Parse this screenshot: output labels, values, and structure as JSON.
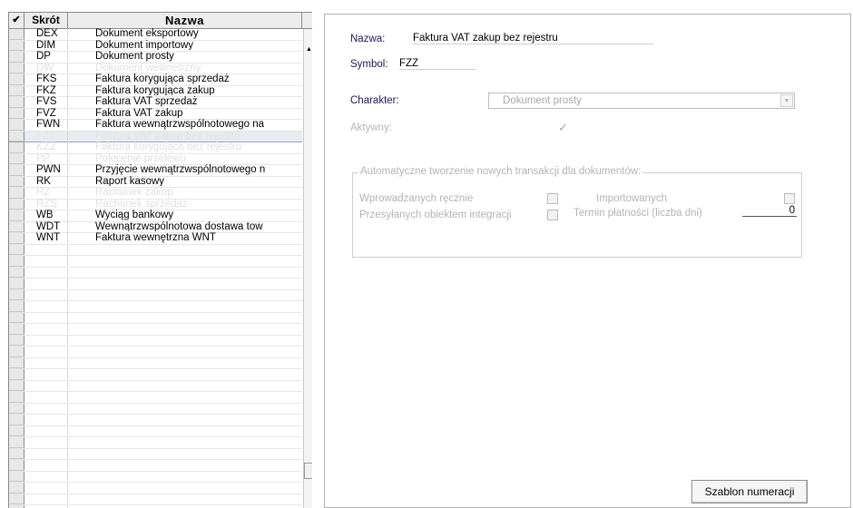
{
  "grid": {
    "header": {
      "check_icon": "checkmark-icon",
      "check_glyph": "✔",
      "col_skrot": "Skrót",
      "col_nazwa": "Nazwa"
    },
    "rows": [
      {
        "skrot": "DEX",
        "nazwa": "Dokument eksportowy",
        "faded": false
      },
      {
        "skrot": "DIM",
        "nazwa": "Dokument importowy",
        "faded": false
      },
      {
        "skrot": "DP",
        "nazwa": "Dokument prosty",
        "faded": false
      },
      {
        "skrot": "DW",
        "nazwa": "Dokument wewnętrzny",
        "faded": true
      },
      {
        "skrot": "FKS",
        "nazwa": "Faktura korygująca sprzedaż",
        "faded": false
      },
      {
        "skrot": "FKZ",
        "nazwa": "Faktura korygująca zakup",
        "faded": false
      },
      {
        "skrot": "FVS",
        "nazwa": "Faktura VAT sprzedaż",
        "faded": false
      },
      {
        "skrot": "FVZ",
        "nazwa": "Faktura VAT zakup",
        "faded": false
      },
      {
        "skrot": "FWN",
        "nazwa": "Faktura wewnątrzwspólnotowego na",
        "faded": false
      },
      {
        "skrot": "FZZ",
        "nazwa": "Faktura VAT zakup bez rejestru",
        "faded": true,
        "selected": true
      },
      {
        "skrot": "KZZ",
        "nazwa": "Faktura korygująca bez rejestru",
        "faded": true
      },
      {
        "skrot": "PP",
        "nazwa": "Polecenie przelewu",
        "faded": true
      },
      {
        "skrot": "PWN",
        "nazwa": "Przyjęcie wewnątrzwspólnotowego n",
        "faded": false
      },
      {
        "skrot": "RK",
        "nazwa": "Raport kasowy",
        "faded": false
      },
      {
        "skrot": "RZ",
        "nazwa": "Rachunek zakup",
        "faded": true
      },
      {
        "skrot": "RZS",
        "nazwa": "Rachunek sprzedaż",
        "faded": true
      },
      {
        "skrot": "WB",
        "nazwa": "Wyciąg bankowy",
        "faded": false
      },
      {
        "skrot": "WDT",
        "nazwa": "Wewnątrzwspólnotowa dostawa tow",
        "faded": false
      },
      {
        "skrot": "WNT",
        "nazwa": "Faktura wewnętrzna WNT",
        "faded": false
      }
    ],
    "empty_rows": 24,
    "scroll_up_glyph": "▲"
  },
  "form": {
    "nazwa_label": "Nazwa:",
    "nazwa_value": "Faktura VAT zakup bez rejestru",
    "symbol_label": "Symbol:",
    "symbol_value": "FZZ",
    "charakter_label": "Charakter:",
    "charakter_value": "Dokument prosty",
    "combo_arrow": "▼",
    "aktywny_label": "Aktywny:",
    "check_glyph": "✓",
    "group_title": "Automatyczne tworzenie nowych transakcji dla dokumentów:",
    "wprowadzanych_label": "Wprowadzanych ręcznie",
    "importowanych_label": "Importowanych",
    "przesylanych_label": "Przesyłanych obiektem integracji",
    "termin_label": "Termin płatności (liczba dni)",
    "termin_value": "0",
    "szablon_button": "Szablon numeracji"
  }
}
